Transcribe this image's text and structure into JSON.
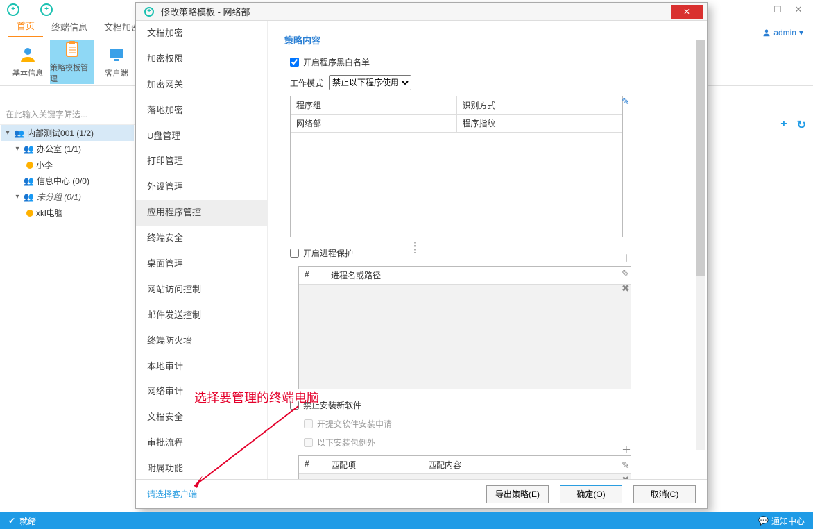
{
  "window": {
    "min": "—",
    "max": "☐",
    "close": "✕"
  },
  "user": {
    "name": "admin",
    "caret": "▾"
  },
  "main_tabs": [
    "首页",
    "终端信息",
    "文档加密"
  ],
  "ribbon": {
    "basic": "基本信息",
    "policy": "策略模板管理",
    "client": "客户端"
  },
  "search_placeholder": "在此输入关键字筛选...",
  "right_tools": {
    "add": "+",
    "refresh": "↻"
  },
  "tree": {
    "n0": "内部测试001 (1/2)",
    "n1": "办公室 (1/1)",
    "n2": "小李",
    "n3": "信息中心 (0/0)",
    "n4": "未分组 (0/1)",
    "n5": "xkl电脑"
  },
  "dialog": {
    "title": "修改策略模板 - 网络部",
    "close": "✕",
    "categories": [
      "文档加密",
      "加密权限",
      "加密网关",
      "落地加密",
      "U盘管理",
      "打印管理",
      "外设管理",
      "应用程序管控",
      "终端安全",
      "桌面管理",
      "网站访问控制",
      "邮件发送控制",
      "终端防火墙",
      "本地审计",
      "网络审计",
      "文档安全",
      "审批流程",
      "附属功能"
    ],
    "content_title": "策略内容",
    "chk_blacklist": "开启程序黑白名单",
    "mode_label": "工作模式",
    "mode_value": "禁止以下程序使用",
    "table1": {
      "h1": "程序组",
      "h2": "识别方式",
      "r1c1": "网络部",
      "r1c2": "程序指纹"
    },
    "edit_glyph": "✎",
    "chk_proc": "开启进程保护",
    "proc_table": {
      "h1": "#",
      "h2": "进程名或路径"
    },
    "side": {
      "add": "＋",
      "edit": "✎",
      "del": "✖"
    },
    "chk_install": "禁止安装新软件",
    "chk_apply": "开提交软件安装申请",
    "chk_except": "以下安装包例外",
    "match_table": {
      "h1": "#",
      "h2": "匹配项",
      "h3": "匹配内容"
    },
    "footer": {
      "select": "请选择客户端",
      "export": "导出策略(E)",
      "ok": "确定(O)",
      "cancel": "取消(C)"
    }
  },
  "annotation": "选择要管理的终端电脑",
  "status": {
    "ready": "就绪",
    "notif": "通知中心",
    "bubble": "💬"
  }
}
